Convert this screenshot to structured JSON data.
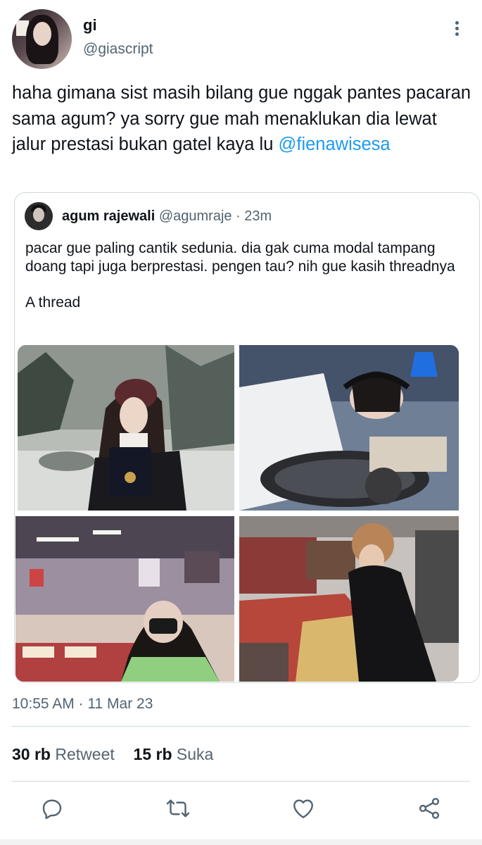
{
  "author": {
    "name": "gi",
    "handle": "@giascript"
  },
  "tweet": {
    "text": "haha gimana sist masih bilang gue nggak pantes pacaran sama agum? ya sorry gue mah menaklukan dia lewat jalur prestasi bukan gatel kaya lu ",
    "mention": "@fienawisesa",
    "timestamp": "10:55 AM · 11 Mar 23"
  },
  "quoted_tweet": {
    "name": "agum rajewali",
    "meta": "@agumraje · 23m",
    "text_line": "pacar gue paling cantik sedunia. dia gak cuma modal tampang doang tapi juga berprestasi. pengen tau? nih gue kasih threadnya",
    "text_line2": "A thread"
  },
  "stats": {
    "retweets_count": "30 rb",
    "retweets_label": "Retweet",
    "likes_count": "15 rb",
    "likes_label": "Suka"
  },
  "icons": {
    "more": "more-vertical-icon",
    "reply": "reply-icon",
    "retweet": "retweet-icon",
    "like": "heart-icon",
    "share": "share-icon"
  },
  "colors": {
    "link": "#1d9bf0",
    "secondary_text": "#536471",
    "border": "#cfd9de"
  }
}
